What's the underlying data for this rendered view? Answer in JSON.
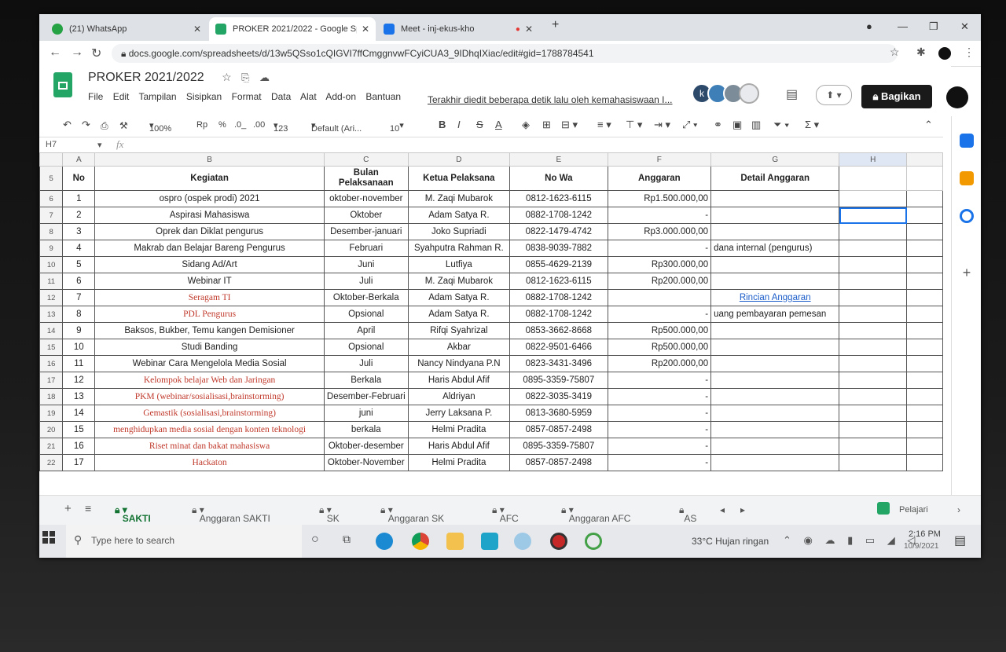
{
  "browser": {
    "tabs": [
      {
        "label": "(21) WhatsApp",
        "icon": "whatsapp-icon",
        "color": "#25a244"
      },
      {
        "label": "PROKER 2021/2022 - Google Spr",
        "icon": "sheets-icon",
        "color": "#23a566"
      },
      {
        "label": "Meet - inj-ekus-kho",
        "icon": "meet-icon",
        "color": "#1a73e8"
      }
    ],
    "new_tab": "+",
    "url": "docs.google.com/spreadsheets/d/13w5QSso1cQIGVI7ffCmggnvwFCyiCUA3_9IDhqIXiac/edit#gid=1788784541"
  },
  "sheet": {
    "title": "PROKER 2021/2022",
    "menu": [
      "File",
      "Edit",
      "Tampilan",
      "Sisipkan",
      "Format",
      "Data",
      "Alat",
      "Add-on",
      "Bantuan"
    ],
    "last_edit": "Terakhir diedit beberapa detik lalu oleh kemahasiswaan I...",
    "share_label": "Bagikan",
    "zoom": "100%",
    "currency": "Rp",
    "percent": "%",
    "dec_less": ".0_",
    "dec_more": ".00",
    "format_more": "123",
    "font": "Default (Ari...",
    "font_size": "10",
    "cell_ref": "H7",
    "fx": "fx"
  },
  "grid": {
    "columns": [
      "A",
      "B",
      "C",
      "D",
      "E",
      "F",
      "G",
      "H"
    ],
    "header_row_num": "5",
    "headers": [
      "No",
      "Kegiatan",
      "Bulan Pelaksanaan",
      "Ketua Pelaksana",
      "No Wa",
      "Anggaran",
      "Detail Anggaran"
    ],
    "rows": [
      {
        "r": "6",
        "no": "1",
        "kegiatan": "ospro (ospek prodi) 2021",
        "bulan": "oktober-november",
        "ketua": "M. Zaqi Mubarok",
        "wa": "0812-1623-6115",
        "anggaran": "Rp1.500.000,00",
        "detail": "",
        "red": false
      },
      {
        "r": "7",
        "no": "2",
        "kegiatan": "Aspirasi Mahasiswa",
        "bulan": "Oktober",
        "ketua": "Adam Satya R.",
        "wa": "0882-1708-1242",
        "anggaran": "-",
        "detail": "",
        "red": false
      },
      {
        "r": "8",
        "no": "3",
        "kegiatan": "Oprek dan Diklat pengurus",
        "bulan": "Desember-januari",
        "ketua": "Joko Supriadi",
        "wa": "0822-1479-4742",
        "anggaran": "Rp3.000.000,00",
        "detail": "",
        "red": false
      },
      {
        "r": "9",
        "no": "4",
        "kegiatan": "Makrab dan Belajar Bareng Pengurus",
        "bulan": "Februari",
        "ketua": "Syahputra Rahman R.",
        "wa": "0838-9039-7882",
        "anggaran": "-",
        "detail": "dana internal (pengurus)",
        "red": false
      },
      {
        "r": "10",
        "no": "5",
        "kegiatan": "Sidang Ad/Art",
        "bulan": "Juni",
        "ketua": "Lutfiya",
        "wa": "0855-4629-2139",
        "anggaran": "Rp300.000,00",
        "detail": "",
        "red": false
      },
      {
        "r": "11",
        "no": "6",
        "kegiatan": "Webinar IT",
        "bulan": "Juli",
        "ketua": "M. Zaqi Mubarok",
        "wa": "0812-1623-6115",
        "anggaran": "Rp200.000,00",
        "detail": "",
        "red": false
      },
      {
        "r": "12",
        "no": "7",
        "kegiatan": "Seragam TI",
        "bulan": "Oktober-Berkala",
        "ketua": "Adam Satya R.",
        "wa": "0882-1708-1242",
        "anggaran": "",
        "detail": "Rincian Anggaran",
        "red": true
      },
      {
        "r": "13",
        "no": "8",
        "kegiatan": "PDL  Pengurus",
        "bulan": "Opsional",
        "ketua": "Adam Satya R.",
        "wa": "0882-1708-1242",
        "anggaran": "-",
        "detail": "uang pembayaran pemesan",
        "red": true
      },
      {
        "r": "14",
        "no": "9",
        "kegiatan": "Baksos, Bukber, Temu kangen Demisioner",
        "bulan": "April",
        "ketua": "Rifqi Syahrizal",
        "wa": "0853-3662-8668",
        "anggaran": "Rp500.000,00",
        "detail": "",
        "red": false
      },
      {
        "r": "15",
        "no": "10",
        "kegiatan": "Studi Banding",
        "bulan": "Opsional",
        "ketua": "Akbar",
        "wa": "0822-9501-6466",
        "anggaran": "Rp500.000,00",
        "detail": "",
        "red": false
      },
      {
        "r": "16",
        "no": "11",
        "kegiatan": "Webinar Cara Mengelola Media Sosial",
        "bulan": "Juli",
        "ketua": "Nancy Nindyana P.N",
        "wa": "0823-3431-3496",
        "anggaran": "Rp200.000,00",
        "detail": "",
        "red": false
      },
      {
        "r": "17",
        "no": "12",
        "kegiatan": "Kelompok belajar Web dan Jaringan",
        "bulan": "Berkala",
        "ketua": "Haris Abdul Afif",
        "wa": "0895-3359-75807",
        "anggaran": "-",
        "detail": "",
        "red": true
      },
      {
        "r": "18",
        "no": "13",
        "kegiatan": "PKM (webinar/sosialisasi,brainstorming)",
        "bulan": "Desember-Februari",
        "ketua": "Aldriyan",
        "wa": "0822-3035-3419",
        "anggaran": "-",
        "detail": "",
        "red": true
      },
      {
        "r": "19",
        "no": "14",
        "kegiatan": "Gemastik (sosialisasi,brainstorming)",
        "bulan": "juni",
        "ketua": "Jerry Laksana P.",
        "wa": "0813-3680-5959",
        "anggaran": "-",
        "detail": "",
        "red": true
      },
      {
        "r": "20",
        "no": "15",
        "kegiatan": "menghidupkan media sosial dengan konten teknologi",
        "bulan": "berkala",
        "ketua": "Helmi Pradita",
        "wa": "0857-0857-2498",
        "anggaran": "-",
        "detail": "",
        "red": true
      },
      {
        "r": "21",
        "no": "16",
        "kegiatan": "Riset minat dan bakat mahasiswa",
        "bulan": "Oktober-desember",
        "ketua": "Haris Abdul Afif",
        "wa": "0895-3359-75807",
        "anggaran": "-",
        "detail": "",
        "red": true
      },
      {
        "r": "22",
        "no": "17",
        "kegiatan": "Hackaton",
        "bulan": "Oktober-November",
        "ketua": "Helmi Pradita",
        "wa": "0857-0857-2498",
        "anggaran": "-",
        "detail": "",
        "red": true
      }
    ]
  },
  "sheet_tabs": [
    "SAKTI",
    "Anggaran SAKTI",
    "SK",
    "Anggaran SK",
    "AFC",
    "Anggaran AFC",
    "AS"
  ],
  "explore_label": "Pelajari",
  "taskbar": {
    "search_placeholder": "Type here to search",
    "weather": "33°C  Hujan ringan",
    "time": "2:16 PM",
    "date": "10/9/2021"
  },
  "colors": {
    "sheets_green": "#23a566",
    "selection_blue": "#1a73e8",
    "red_text": "#c0392b",
    "link_blue": "#1a5cc9"
  }
}
